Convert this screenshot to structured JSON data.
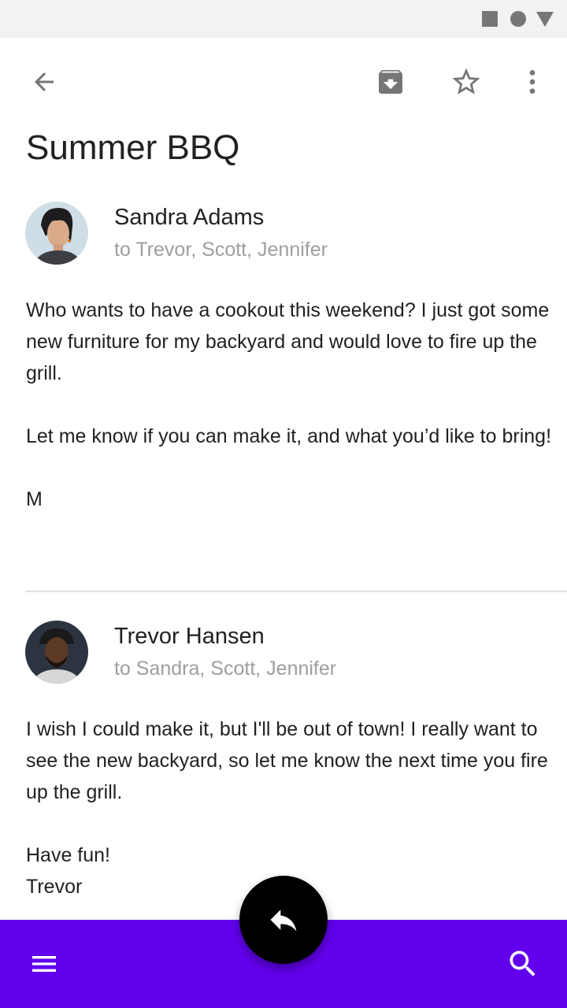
{
  "status_bar": {
    "icons": [
      "stop-square-icon",
      "circle-icon",
      "triangle-icon"
    ]
  },
  "toolbar": {
    "back_icon": "arrow-back-icon",
    "archive_icon": "archive-icon",
    "star_icon": "star-outline-icon",
    "more_icon": "more-vert-icon"
  },
  "email": {
    "subject": "Summer BBQ",
    "messages": [
      {
        "sender": "Sandra Adams",
        "recipients": "to Trevor, Scott, Jennifer",
        "paragraphs": [
          "Who wants to have a cookout this weekend? I just got some new furniture for my backyard and would love to fire up the grill.",
          "Let me know if you can make it, and what you’d like to bring!",
          "M"
        ]
      },
      {
        "sender": "Trevor Hansen",
        "recipients": "to Sandra, Scott, Jennifer",
        "paragraphs": [
          "I wish I could make it, but I'll be out of town! I really want to see the new backyard, so let me know the next time you fire up the grill.",
          "Have fun!\nTrevor"
        ]
      }
    ]
  },
  "bottom_bar": {
    "menu_icon": "menu-icon",
    "search_icon": "search-icon",
    "fab_icon": "reply-icon"
  },
  "colors": {
    "bottom_bar": "#6200ee",
    "fab": "#000000",
    "status_bar": "#f2f2f2",
    "icon_gray": "#767676",
    "secondary_text": "#9e9e9e"
  }
}
